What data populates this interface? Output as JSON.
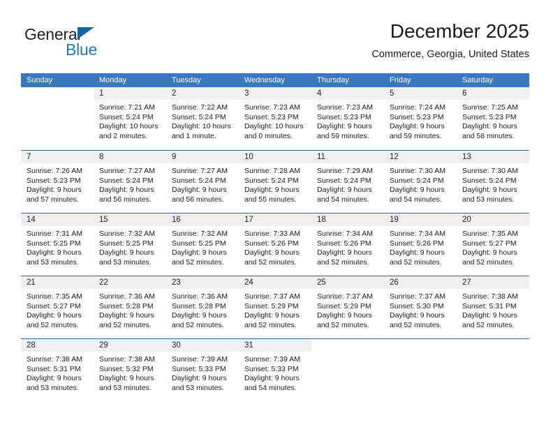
{
  "brand": {
    "name_part1": "General",
    "name_part2": "Blue",
    "accent_color": "#1e78c8",
    "triangle_color": "#1464aa"
  },
  "header": {
    "month_title": "December 2025",
    "location": "Commerce, Georgia, United States",
    "header_bg_color": "#3879bd",
    "row_border_color": "#2b6cad",
    "day_band_color": "#f0f0f0"
  },
  "weekdays": [
    "Sunday",
    "Monday",
    "Tuesday",
    "Wednesday",
    "Thursday",
    "Friday",
    "Saturday"
  ],
  "weeks": [
    [
      {
        "day": "",
        "lines": []
      },
      {
        "day": "1",
        "lines": [
          "Sunrise: 7:21 AM",
          "Sunset: 5:24 PM",
          "Daylight: 10 hours",
          "and 2 minutes."
        ]
      },
      {
        "day": "2",
        "lines": [
          "Sunrise: 7:22 AM",
          "Sunset: 5:24 PM",
          "Daylight: 10 hours",
          "and 1 minute."
        ]
      },
      {
        "day": "3",
        "lines": [
          "Sunrise: 7:23 AM",
          "Sunset: 5:23 PM",
          "Daylight: 10 hours",
          "and 0 minutes."
        ]
      },
      {
        "day": "4",
        "lines": [
          "Sunrise: 7:23 AM",
          "Sunset: 5:23 PM",
          "Daylight: 9 hours",
          "and 59 minutes."
        ]
      },
      {
        "day": "5",
        "lines": [
          "Sunrise: 7:24 AM",
          "Sunset: 5:23 PM",
          "Daylight: 9 hours",
          "and 59 minutes."
        ]
      },
      {
        "day": "6",
        "lines": [
          "Sunrise: 7:25 AM",
          "Sunset: 5:23 PM",
          "Daylight: 9 hours",
          "and 58 minutes."
        ]
      }
    ],
    [
      {
        "day": "7",
        "lines": [
          "Sunrise: 7:26 AM",
          "Sunset: 5:23 PM",
          "Daylight: 9 hours",
          "and 57 minutes."
        ]
      },
      {
        "day": "8",
        "lines": [
          "Sunrise: 7:27 AM",
          "Sunset: 5:24 PM",
          "Daylight: 9 hours",
          "and 56 minutes."
        ]
      },
      {
        "day": "9",
        "lines": [
          "Sunrise: 7:27 AM",
          "Sunset: 5:24 PM",
          "Daylight: 9 hours",
          "and 56 minutes."
        ]
      },
      {
        "day": "10",
        "lines": [
          "Sunrise: 7:28 AM",
          "Sunset: 5:24 PM",
          "Daylight: 9 hours",
          "and 55 minutes."
        ]
      },
      {
        "day": "11",
        "lines": [
          "Sunrise: 7:29 AM",
          "Sunset: 5:24 PM",
          "Daylight: 9 hours",
          "and 54 minutes."
        ]
      },
      {
        "day": "12",
        "lines": [
          "Sunrise: 7:30 AM",
          "Sunset: 5:24 PM",
          "Daylight: 9 hours",
          "and 54 minutes."
        ]
      },
      {
        "day": "13",
        "lines": [
          "Sunrise: 7:30 AM",
          "Sunset: 5:24 PM",
          "Daylight: 9 hours",
          "and 53 minutes."
        ]
      }
    ],
    [
      {
        "day": "14",
        "lines": [
          "Sunrise: 7:31 AM",
          "Sunset: 5:25 PM",
          "Daylight: 9 hours",
          "and 53 minutes."
        ]
      },
      {
        "day": "15",
        "lines": [
          "Sunrise: 7:32 AM",
          "Sunset: 5:25 PM",
          "Daylight: 9 hours",
          "and 53 minutes."
        ]
      },
      {
        "day": "16",
        "lines": [
          "Sunrise: 7:32 AM",
          "Sunset: 5:25 PM",
          "Daylight: 9 hours",
          "and 52 minutes."
        ]
      },
      {
        "day": "17",
        "lines": [
          "Sunrise: 7:33 AM",
          "Sunset: 5:26 PM",
          "Daylight: 9 hours",
          "and 52 minutes."
        ]
      },
      {
        "day": "18",
        "lines": [
          "Sunrise: 7:34 AM",
          "Sunset: 5:26 PM",
          "Daylight: 9 hours",
          "and 52 minutes."
        ]
      },
      {
        "day": "19",
        "lines": [
          "Sunrise: 7:34 AM",
          "Sunset: 5:26 PM",
          "Daylight: 9 hours",
          "and 52 minutes."
        ]
      },
      {
        "day": "20",
        "lines": [
          "Sunrise: 7:35 AM",
          "Sunset: 5:27 PM",
          "Daylight: 9 hours",
          "and 52 minutes."
        ]
      }
    ],
    [
      {
        "day": "21",
        "lines": [
          "Sunrise: 7:35 AM",
          "Sunset: 5:27 PM",
          "Daylight: 9 hours",
          "and 52 minutes."
        ]
      },
      {
        "day": "22",
        "lines": [
          "Sunrise: 7:36 AM",
          "Sunset: 5:28 PM",
          "Daylight: 9 hours",
          "and 52 minutes."
        ]
      },
      {
        "day": "23",
        "lines": [
          "Sunrise: 7:36 AM",
          "Sunset: 5:28 PM",
          "Daylight: 9 hours",
          "and 52 minutes."
        ]
      },
      {
        "day": "24",
        "lines": [
          "Sunrise: 7:37 AM",
          "Sunset: 5:29 PM",
          "Daylight: 9 hours",
          "and 52 minutes."
        ]
      },
      {
        "day": "25",
        "lines": [
          "Sunrise: 7:37 AM",
          "Sunset: 5:29 PM",
          "Daylight: 9 hours",
          "and 52 minutes."
        ]
      },
      {
        "day": "26",
        "lines": [
          "Sunrise: 7:37 AM",
          "Sunset: 5:30 PM",
          "Daylight: 9 hours",
          "and 52 minutes."
        ]
      },
      {
        "day": "27",
        "lines": [
          "Sunrise: 7:38 AM",
          "Sunset: 5:31 PM",
          "Daylight: 9 hours",
          "and 52 minutes."
        ]
      }
    ],
    [
      {
        "day": "28",
        "lines": [
          "Sunrise: 7:38 AM",
          "Sunset: 5:31 PM",
          "Daylight: 9 hours",
          "and 53 minutes."
        ]
      },
      {
        "day": "29",
        "lines": [
          "Sunrise: 7:38 AM",
          "Sunset: 5:32 PM",
          "Daylight: 9 hours",
          "and 53 minutes."
        ]
      },
      {
        "day": "30",
        "lines": [
          "Sunrise: 7:39 AM",
          "Sunset: 5:33 PM",
          "Daylight: 9 hours",
          "and 53 minutes."
        ]
      },
      {
        "day": "31",
        "lines": [
          "Sunrise: 7:39 AM",
          "Sunset: 5:33 PM",
          "Daylight: 9 hours",
          "and 54 minutes."
        ]
      },
      {
        "day": "",
        "lines": []
      },
      {
        "day": "",
        "lines": []
      },
      {
        "day": "",
        "lines": []
      }
    ]
  ]
}
